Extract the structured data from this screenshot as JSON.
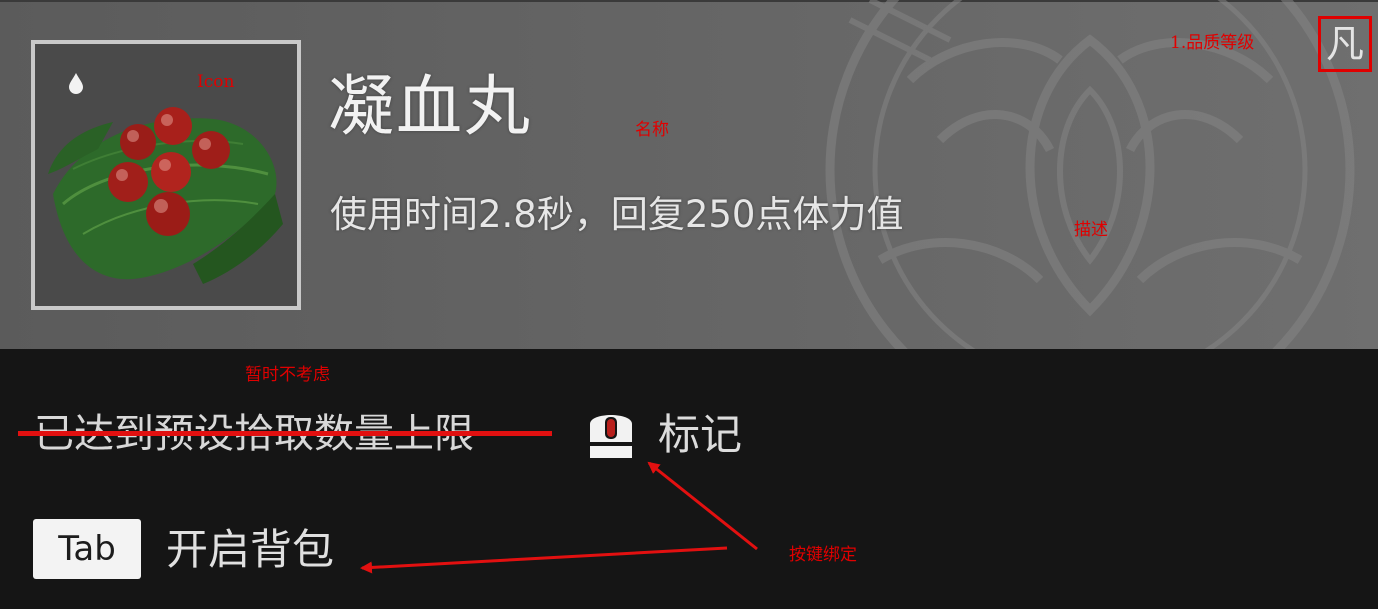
{
  "item": {
    "name": "凝血丸",
    "description": "使用时间2.8秒，回复250点体力值",
    "quality_label": "凡"
  },
  "footer": {
    "limit_text": "已达到预设拾取数量上限",
    "mark": {
      "key_icon": "mouse-button-icon",
      "label": "标记"
    },
    "bag": {
      "key": "Tab",
      "label": "开启背包"
    }
  },
  "annotations": {
    "icon": "Icon",
    "name": "名称",
    "quality": "1.品质等级",
    "description": "描述",
    "ignore": "暂时不考虑",
    "keybind": "按键绑定"
  },
  "colors": {
    "annotation_red": "#e00000",
    "panel_gray": "#626262",
    "footer_dark": "#151515",
    "pill_red": "#b8201c"
  }
}
